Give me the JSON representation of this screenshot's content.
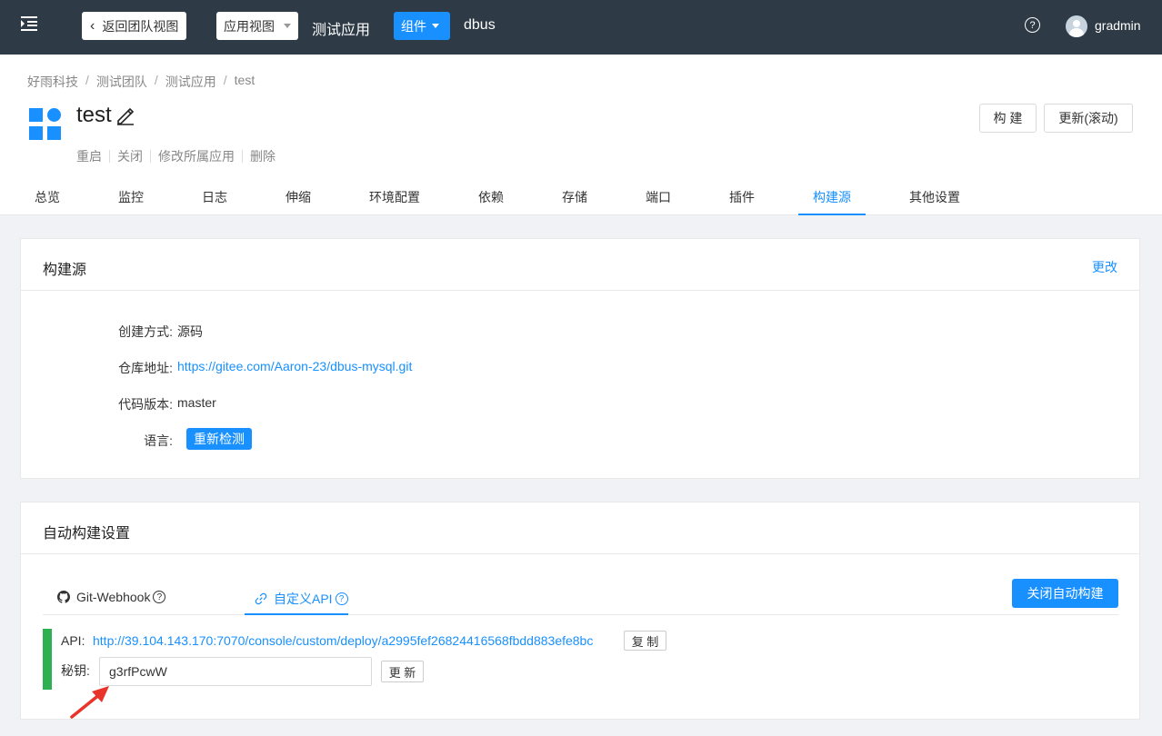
{
  "topbar": {
    "back_label": "返回团队视图",
    "view_select": "应用视图",
    "app_name": "测试应用",
    "component_button": "组件",
    "component_name": "dbus",
    "help_glyph": "?",
    "username": "gradmin"
  },
  "breadcrumb": [
    "好雨科技",
    "测试团队",
    "测试应用",
    "test"
  ],
  "breadcrumb_sep": "/",
  "header": {
    "title": "test",
    "actions": [
      "重启",
      "关闭",
      "修改所属应用",
      "删除"
    ],
    "build_label": "构 建",
    "update_label": "更新(滚动)"
  },
  "tabs": [
    "总览",
    "监控",
    "日志",
    "伸缩",
    "环境配置",
    "依赖",
    "存储",
    "端口",
    "插件",
    "构建源",
    "其他设置"
  ],
  "active_tab": "构建源",
  "build_source": {
    "title": "构建源",
    "change_link": "更改",
    "create_label": "创建方式:",
    "create_value": "源码",
    "repo_label": "仓库地址:",
    "repo_value": "https://gitee.com/Aaron-23/dbus-mysql.git",
    "version_label": "代码版本:",
    "version_value": "master",
    "lang_label": "语言:",
    "detect_button": "重新检测"
  },
  "auto_build": {
    "title": "自动构建设置",
    "tab_webhook": "Git-Webhook",
    "tab_api": "自定义API",
    "close_button": "关闭自动构建",
    "api_label": "API:",
    "api_url": "http://39.104.143.170:7070/console/custom/deploy/a2995fef26824416568fbdd883efe8bc",
    "copy_button": "复 制",
    "key_label": "秘钥:",
    "key_value": "g3rfPcwW",
    "refresh_button": "更 新"
  },
  "colors": {
    "topbar": "#2e3a45",
    "accent": "#1890ff",
    "api_bar": "#2eb050",
    "arrow": "#e8342a"
  }
}
